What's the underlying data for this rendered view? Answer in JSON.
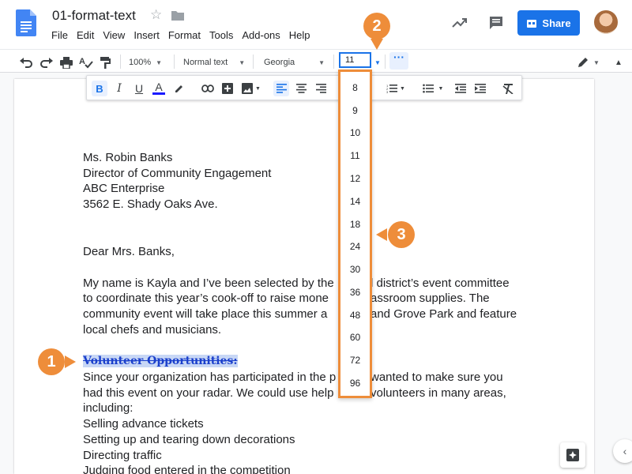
{
  "document": {
    "title": "01-format-text"
  },
  "menu": [
    "File",
    "Edit",
    "View",
    "Insert",
    "Format",
    "Tools",
    "Add-ons",
    "Help"
  ],
  "header": {
    "share_label": "Share"
  },
  "toolbar": {
    "zoom": "100%",
    "style": "Normal text",
    "font": "Georgia",
    "font_size": "11",
    "more_label": "···"
  },
  "font_size_options": [
    "8",
    "9",
    "10",
    "11",
    "12",
    "14",
    "18",
    "24",
    "30",
    "36",
    "48",
    "60",
    "72",
    "96"
  ],
  "letter": {
    "address": [
      "Ms. Robin Banks",
      "Director of Community Engagement",
      "ABC Enterprise",
      "3562 E. Shady Oaks Ave."
    ],
    "salutation": "Dear Mrs. Banks,",
    "para1": [
      "My name is Kayla and I’ve been selected by the",
      "to coordinate this year’s cook-off to raise mone",
      "community event will take place this summer a",
      "local chefs and musicians."
    ],
    "para1_right": [
      "l district’s event committee",
      "assroom supplies. The",
      "and Grove Park and feature",
      ""
    ],
    "heading": "Volunteer Opportunities:",
    "para2": [
      "Since your organization has participated in the p",
      "had this event on your radar. We could use help",
      "including:"
    ],
    "para2_right": [
      "wanted to make sure you",
      "volunteers in many areas,",
      ""
    ],
    "list": [
      "Selling advance tickets",
      "Setting up and tearing down decorations",
      "Directing traffic",
      "Judging food entered in the competition"
    ]
  },
  "callouts": [
    "1",
    "2",
    "3"
  ],
  "colors": {
    "accent": "#1a73e8",
    "callout": "#ee8d3a",
    "selection": "#c8d7f5"
  }
}
